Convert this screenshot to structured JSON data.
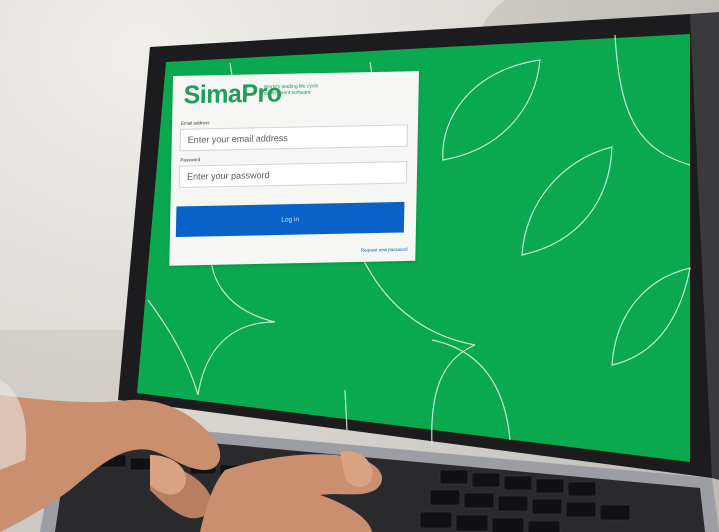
{
  "brand": {
    "logo_text": "SimaPro",
    "tagline": "World's leading life cycle assessment software",
    "accent": "#1f9e57"
  },
  "login": {
    "email_label": "Email address",
    "email_placeholder": "Enter your email address",
    "password_label": "Password",
    "password_placeholder": "Enter your password",
    "button_label": "Log in",
    "forgot_link": "Request new password",
    "button_color": "#0a62c8"
  },
  "screen": {
    "background_color": "#0aa84f"
  }
}
